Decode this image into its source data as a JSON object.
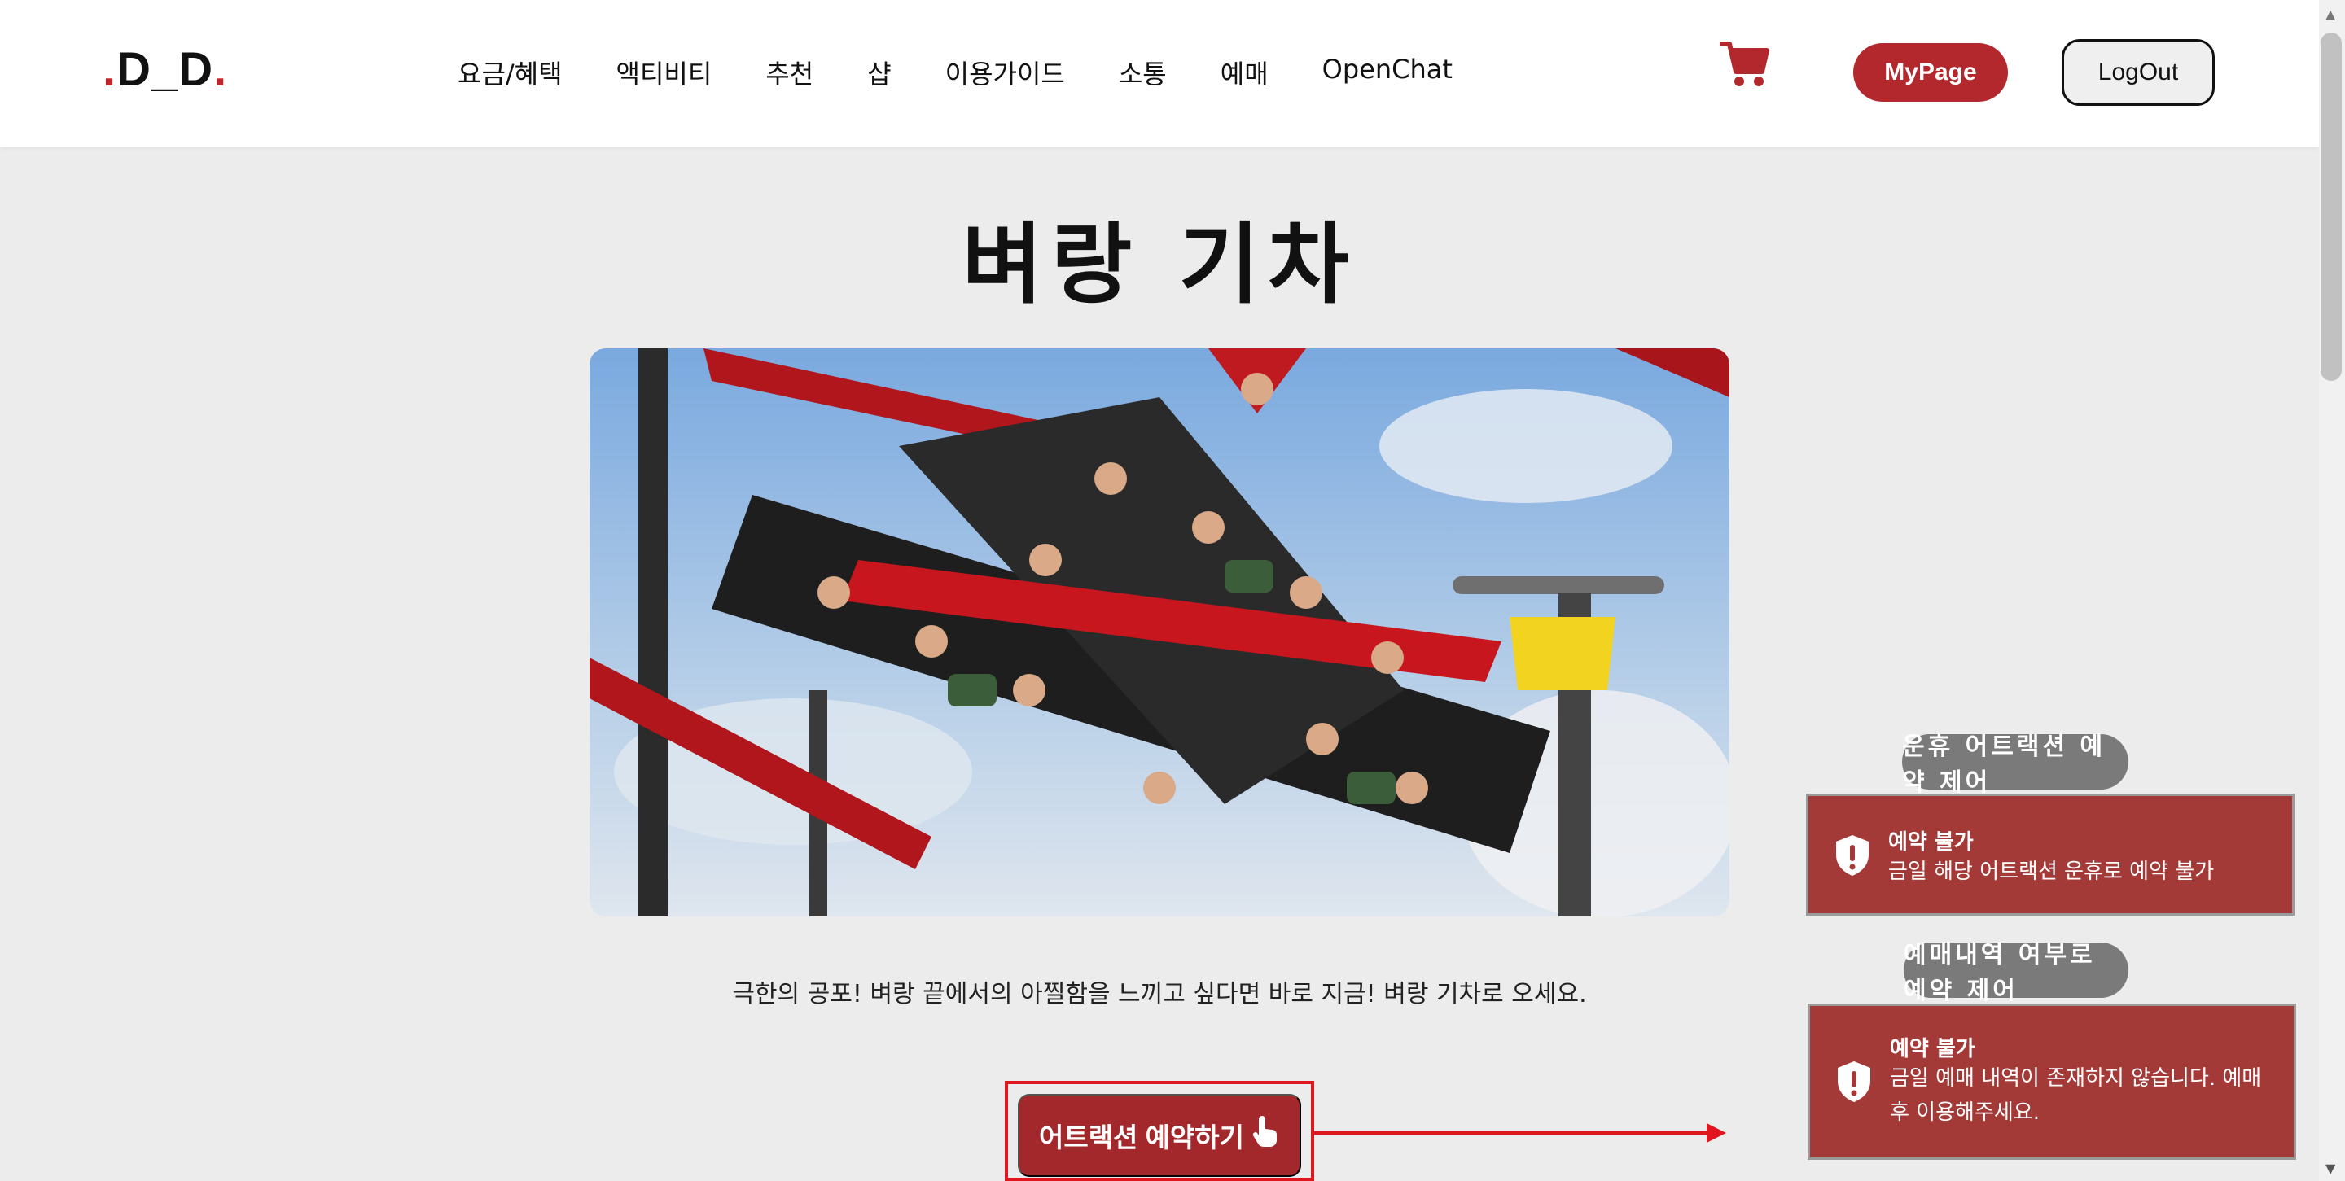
{
  "header": {
    "logo": {
      "dot_left": ".",
      "text": "D_D",
      "dot_right": "."
    },
    "nav": [
      "요금/혜택",
      "액티비티",
      "추천",
      "샵",
      "이용가이드",
      "소통",
      "예매",
      "OpenChat"
    ],
    "mypage_label": "MyPage",
    "logout_label": "LogOut"
  },
  "main": {
    "title": "벼랑 기차",
    "description": "극한의 공포! 벼랑 끝에서의 아찔함을 느끼고 싶다면 바로 지금! 벼랑 기차로 오세요.",
    "reserve_label": "어트랙션 예약하기"
  },
  "notices": [
    {
      "pill": "운휴 어트랙션 예약 제어",
      "title": "예약 불가",
      "message": "금일 해당 어트랙션 운휴로 예약 불가"
    },
    {
      "pill": "예매내역 여부로 예약 제어",
      "title": "예약 불가",
      "message": "금일 예매 내역이 존재하지 않습니다. 예매 후 이용해주세요."
    }
  ],
  "colors": {
    "brand_red": "#b3282d",
    "toast_red": "#a33a38",
    "annotation_red": "#e0161e",
    "pill_gray": "#7a7a7a"
  },
  "icons": {
    "cart": "cart-icon",
    "reserve": "pointing-hand-icon",
    "toast": "shield-exclamation-icon"
  }
}
